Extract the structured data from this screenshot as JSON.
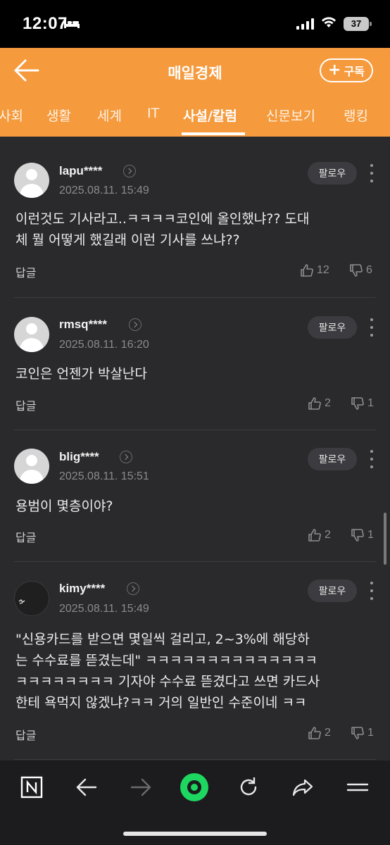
{
  "status_bar": {
    "time": "12:07",
    "battery": "37"
  },
  "header": {
    "title": "매일경제",
    "subscribe_label": "구독"
  },
  "tabs": [
    {
      "label": "사회"
    },
    {
      "label": "생활"
    },
    {
      "label": "세계"
    },
    {
      "label": "IT"
    },
    {
      "label": "사설/칼럼",
      "active": true
    },
    {
      "label": "신문보기"
    },
    {
      "label": "랭킹"
    }
  ],
  "comments": [
    {
      "username": "lapu****",
      "date": "2025.08.11. 15:49",
      "follow_label": "팔로우",
      "text_lines": [
        "이런것도 기사라고..ㅋㅋㅋㅋ코인에 올인했냐?? 도대",
        "체 뭘 어떻게 했길래 이런 기사를 쓰냐??"
      ],
      "reply_label": "답글",
      "likes": "12",
      "dislikes": "6"
    },
    {
      "username": "rmsq****",
      "date": "2025.08.11. 16:20",
      "follow_label": "팔로우",
      "text_lines": [
        "코인은 언젠가 박살난다"
      ],
      "reply_label": "답글",
      "likes": "2",
      "dislikes": "1"
    },
    {
      "username": "blig****",
      "date": "2025.08.11. 15:51",
      "follow_label": "팔로우",
      "text_lines": [
        "용범이 몇층이야?"
      ],
      "reply_label": "답글",
      "likes": "2",
      "dislikes": "1"
    },
    {
      "username": "kimy****",
      "date": "2025.08.11. 15:49",
      "follow_label": "팔로우",
      "text_lines": [
        "\"신용카드를 받으면 몇일씩 걸리고, 2~3%에 해당하",
        "는 수수료를 뜯겼는데\" ㅋㅋㅋㅋㅋㅋㅋㅋㅋㅋㅋㅋㅋㅋ",
        "ㅋㅋㅋㅋㅋㅋㅋㅋ 기자야 수수료 뜯겼다고 쓰면 카드사",
        "한테 욕먹지 않겠냐?ㅋㅋ 거의 일반인 수준이네 ㅋㅋ"
      ],
      "reply_label": "답글",
      "likes": "2",
      "dislikes": "1"
    }
  ],
  "colors": {
    "accent": "#f59a3d",
    "background": "#2a2a2d",
    "nav_active": "#1ed760"
  },
  "bottom_nav": [
    "naver-icon",
    "back-arrow-icon",
    "forward-arrow-icon",
    "home-icon",
    "refresh-icon",
    "share-icon",
    "menu-icon"
  ]
}
